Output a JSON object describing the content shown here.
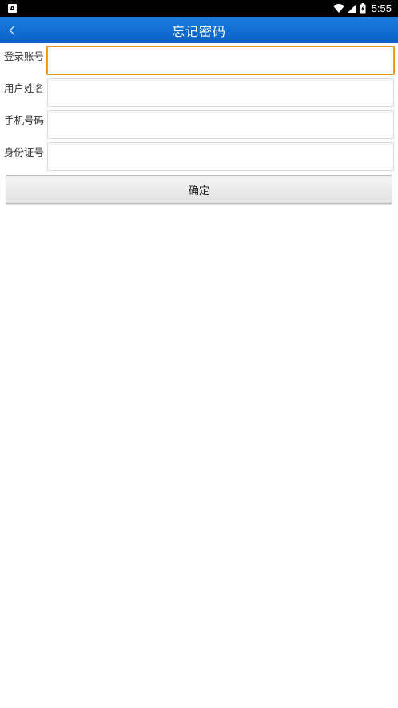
{
  "status_bar": {
    "notification_icon": "A",
    "time": "5:55",
    "icons": [
      "wifi-icon",
      "cell-signal-icon",
      "battery-icon"
    ]
  },
  "header": {
    "title": "忘记密码",
    "back_icon": "chevron-left-icon",
    "color": "#0b5fc5"
  },
  "form": {
    "fields": [
      {
        "label": "登录账号",
        "value": "",
        "placeholder": "",
        "focused": true
      },
      {
        "label": "用户姓名",
        "value": "",
        "placeholder": ""
      },
      {
        "label": "手机号码",
        "value": "",
        "placeholder": ""
      },
      {
        "label": "身份证号",
        "value": "",
        "placeholder": ""
      }
    ],
    "focus_color": "#f39a1e"
  },
  "confirm_button": {
    "label": "确定"
  }
}
